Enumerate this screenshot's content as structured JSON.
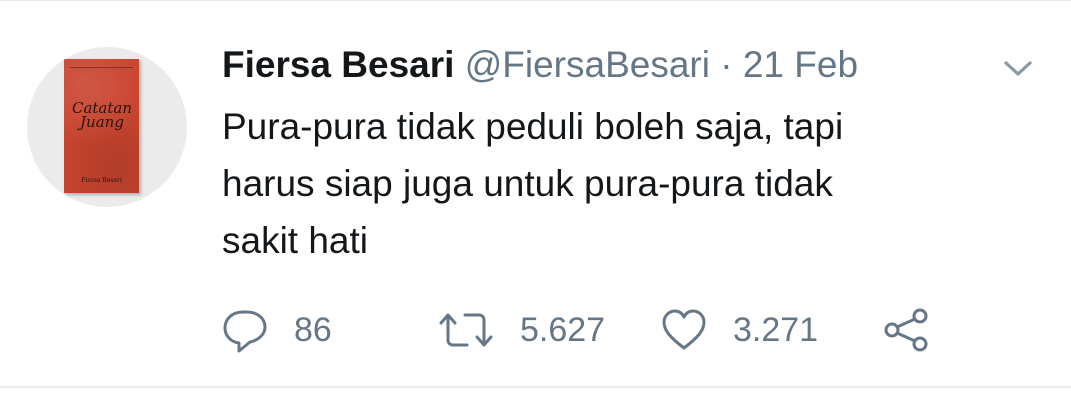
{
  "tweet": {
    "author_name": "Fiersa Besari",
    "handle": "@FiersaBesari",
    "separator": "·",
    "date": "21 Feb",
    "text_lines": [
      "Pura-pura tidak peduli boleh saja, tapi",
      "harus siap juga untuk pura-pura tidak",
      "sakit hati"
    ]
  },
  "avatar": {
    "book_title_line1": "Catatan",
    "book_title_line2": "Juang",
    "book_author": "Fiersa Besari"
  },
  "actions": {
    "reply_count": "86",
    "retweet_count": "5.627",
    "like_count": "3.271"
  },
  "icons": {
    "reply": "speech-bubble-icon",
    "retweet": "retweet-icon",
    "like": "heart-icon",
    "share": "share-icon",
    "menu": "chevron-down-icon"
  },
  "colors": {
    "text": "#14171a",
    "secondary": "#657786",
    "divider": "#e6ecf0",
    "book_cover": "#c9452f"
  }
}
